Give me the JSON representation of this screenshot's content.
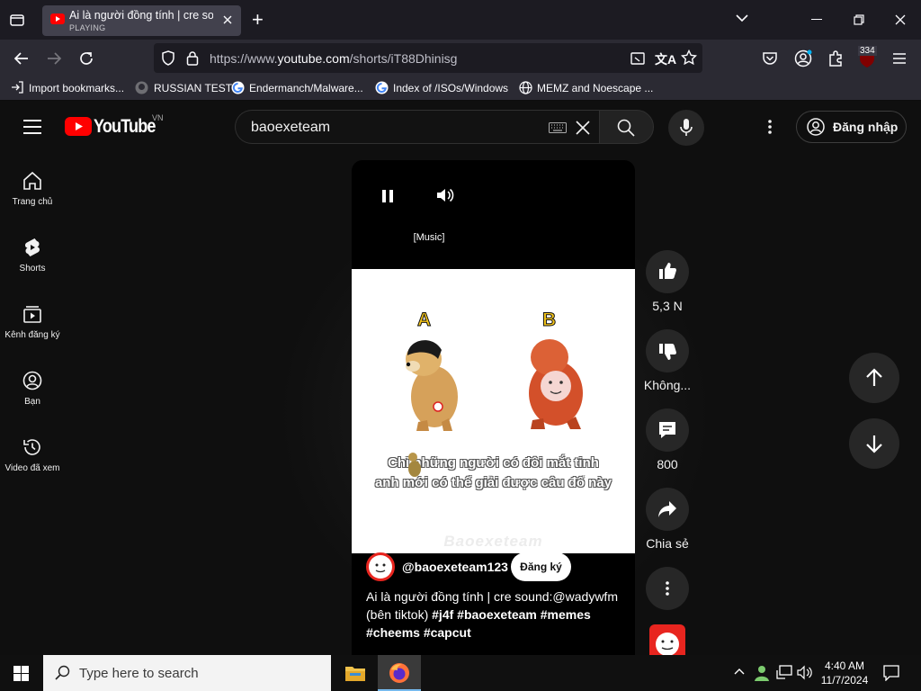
{
  "browser": {
    "tab": {
      "title": "Ai là người đồng tính | cre sound:@wadywfm",
      "status": "PLAYING"
    },
    "new_tab_label": "+",
    "url_prefix": "https://www.",
    "url_domain": "youtube.com",
    "url_path": "/shorts/iT88Dhinisg",
    "extension_badge": "334",
    "bookmarks": [
      {
        "label": "Import bookmarks...",
        "icon": "import-icon"
      },
      {
        "label": "RUSSIAN TEST",
        "icon": "github-icon"
      },
      {
        "label": "Endermanch/Malware...",
        "icon": "google-icon"
      },
      {
        "label": "Index of /ISOs/Windows",
        "icon": "google-icon"
      },
      {
        "label": "MEMZ and Noescape ...",
        "icon": "globe-icon"
      }
    ]
  },
  "youtube": {
    "logo_text": "YouTube",
    "region": "VN",
    "search_query": "baoexeteam",
    "signin_label": "Đăng nhập",
    "sidebar": [
      {
        "label": "Trang chủ",
        "icon": "home-icon"
      },
      {
        "label": "Shorts",
        "icon": "shorts-icon"
      },
      {
        "label": "Kênh đăng ký",
        "icon": "subscriptions-icon"
      },
      {
        "label": "Bạn",
        "icon": "you-icon"
      },
      {
        "label": "Video đã xem",
        "icon": "history-icon"
      }
    ],
    "short": {
      "caption": "[Music]",
      "meme_letter_a": "A",
      "meme_letter_b": "B",
      "subtitle_line1": "Chỉ những người có đôi mắt tinh",
      "subtitle_line2": "anh mới có thể giải được câu đố này",
      "watermark": "Baoexeteam",
      "channel": "@baoexeteam123",
      "subscribe_label": "Đăng ký",
      "description_text": "Ai là người đồng tính | cre sound:@wadywfm (bên tiktok) ",
      "hashtags": "#j4f #baoexeteam #memes #cheems #capcut"
    },
    "actions": {
      "like_count": "5,3 N",
      "dislike_label": "Không...",
      "comments_count": "800",
      "share_label": "Chia sẻ"
    }
  },
  "taskbar": {
    "search_placeholder": "Type here to search",
    "time": "4:40 AM",
    "date": "11/7/2024"
  },
  "colors": {
    "yt_red": "#ff0000",
    "bg": "#0f0f0f",
    "tab_active": "#42414d"
  }
}
